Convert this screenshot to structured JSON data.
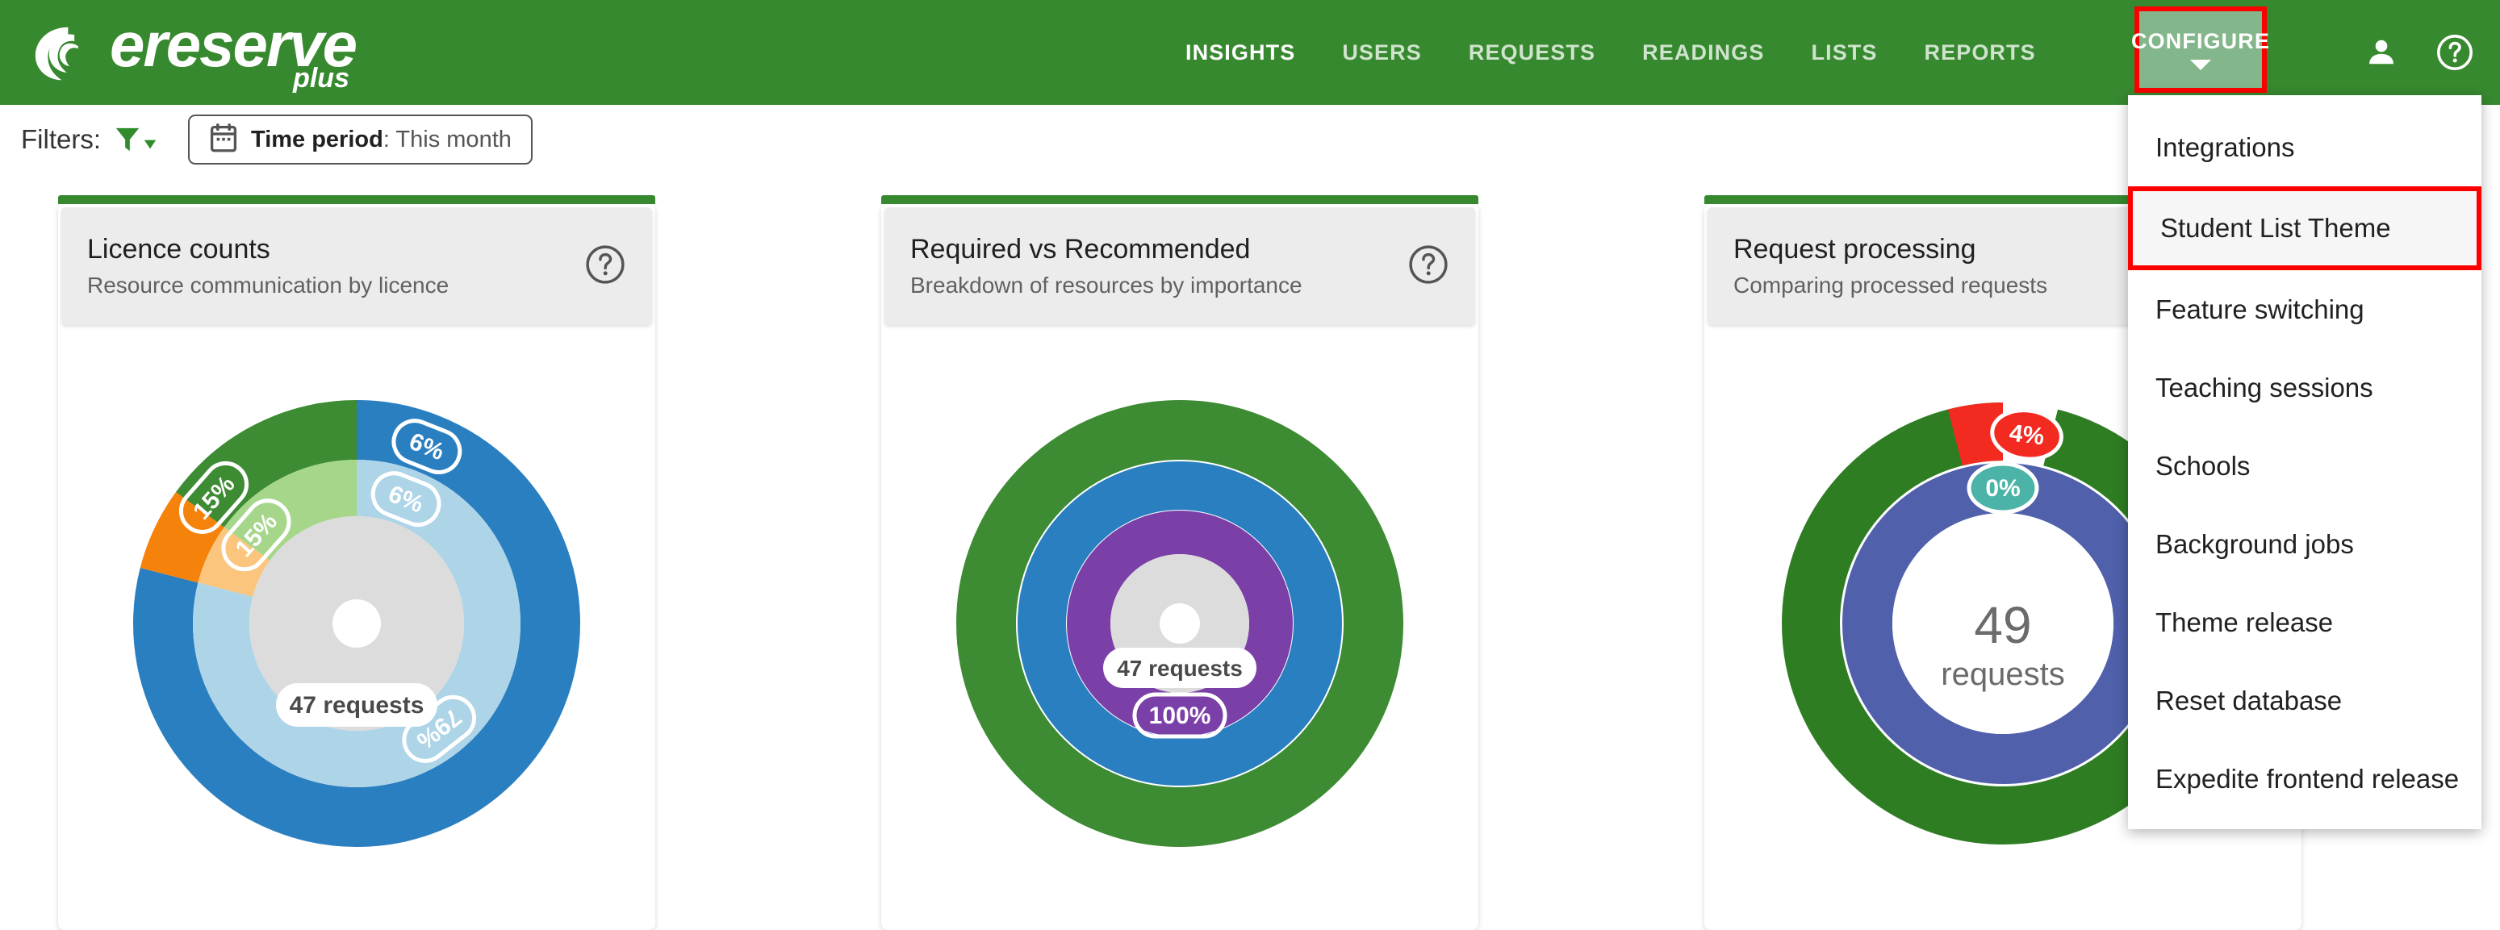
{
  "brand": {
    "name": "ereserve",
    "suffix": "plus",
    "logo_icon": "spiral-swirl-logo-icon",
    "header_color": "#37892f"
  },
  "nav": {
    "items": [
      {
        "label": "INSIGHTS",
        "active": true
      },
      {
        "label": "USERS",
        "active": false
      },
      {
        "label": "REQUESTS",
        "active": false
      },
      {
        "label": "READINGS",
        "active": false
      },
      {
        "label": "LISTS",
        "active": false
      },
      {
        "label": "REPORTS",
        "active": false
      }
    ],
    "configure": {
      "label": "CONFIGURE",
      "highlight_color": "#fc0000",
      "active_bg": "#84b68b",
      "caret_icon": "chevron-down-icon"
    },
    "account_icon": "person-icon",
    "help_icon": "help-circle-icon"
  },
  "dropdown": {
    "selected": "Student List Theme",
    "highlight_color": "#fc0000",
    "items": [
      {
        "label": "Integrations",
        "selected": false
      },
      {
        "label": "Student List Theme",
        "selected": true
      },
      {
        "label": "Feature switching",
        "selected": false
      },
      {
        "label": "Teaching sessions",
        "selected": false
      },
      {
        "label": "Schools",
        "selected": false
      },
      {
        "label": "Background jobs",
        "selected": false
      },
      {
        "label": "Theme release",
        "selected": false
      },
      {
        "label": "Reset database",
        "selected": false
      },
      {
        "label": "Expedite frontend release",
        "selected": false
      }
    ]
  },
  "filters": {
    "label": "Filters:",
    "funnel_icon": "filter-funnel-icon",
    "time_period": {
      "calendar_icon": "calendar-icon",
      "key": "Time period",
      "separator": ": ",
      "value": "This month"
    }
  },
  "cards": [
    {
      "title": "Licence counts",
      "subtitle": "Resource communication by licence",
      "help_icon": "help-circle-icon"
    },
    {
      "title": "Required vs Recommended",
      "subtitle": "Breakdown of resources by importance",
      "help_icon": "help-circle-icon"
    },
    {
      "title": "Request processing",
      "subtitle": "Comparing processed requests",
      "help_icon": "help-circle-icon"
    }
  ],
  "chart_data": [
    {
      "type": "pie",
      "title": "Licence counts",
      "subtitle": "Resource communication by licence",
      "variant": "multi-ring-sunburst",
      "center_label": "47 requests",
      "center_value": 47,
      "center_unit": "requests",
      "rings": [
        {
          "name": "outer",
          "slices": [
            {
              "label": "79%",
              "value": 79,
              "color": "#2a7fc0",
              "show_label": false
            },
            {
              "label": "6%",
              "value": 6,
              "color": "#f5820b",
              "show_label": true
            },
            {
              "label": "15%",
              "value": 15,
              "color": "#3d8b33",
              "show_label": true
            }
          ]
        },
        {
          "name": "inner",
          "slices": [
            {
              "label": "79%",
              "value": 79,
              "color": "#aed4e8",
              "show_label": true
            },
            {
              "label": "6%",
              "value": 6,
              "color": "#fbc57e",
              "show_label": true
            },
            {
              "label": "15%",
              "value": 15,
              "color": "#a5d68a",
              "show_label": true
            }
          ]
        }
      ],
      "hub_color": "#dcdcdc"
    },
    {
      "type": "pie",
      "title": "Required vs Recommended",
      "subtitle": "Breakdown of resources by importance",
      "variant": "multi-ring-sunburst",
      "center_label": "47 requests",
      "center_value": 47,
      "center_unit": "requests",
      "rings": [
        {
          "name": "outer",
          "slices": [
            {
              "label": "100%",
              "value": 100,
              "color": "#3d8b33",
              "show_label": false
            }
          ]
        },
        {
          "name": "middle",
          "slices": [
            {
              "label": "100%",
              "value": 100,
              "color": "#2a7fc0",
              "show_label": false
            }
          ]
        },
        {
          "name": "inner",
          "slices": [
            {
              "label": "100%",
              "value": 100,
              "color": "#7b3fa8",
              "show_label": true
            }
          ]
        }
      ],
      "hub_color": "#dcdcdc"
    },
    {
      "type": "pie",
      "title": "Request processing",
      "subtitle": "Comparing processed requests",
      "variant": "multi-ring-donut",
      "center_value": "49",
      "center_unit": "requests",
      "rings": [
        {
          "name": "outer",
          "slices": [
            {
              "label": "96%",
              "value": 96,
              "color": "#2e7d23",
              "show_label": false
            },
            {
              "label": "4%",
              "value": 4,
              "color": "#f22a20",
              "show_label": true,
              "badge_fill": "#f22a20"
            }
          ]
        },
        {
          "name": "inner",
          "slices": [
            {
              "label": "100%",
              "value": 100,
              "color": "#5060ab",
              "show_label": false
            },
            {
              "label": "0%",
              "value": 0,
              "color": "#4cb3a8",
              "show_label": true,
              "badge_fill": "#4cb3a8"
            }
          ]
        }
      ],
      "hub_color": "#ffffff"
    }
  ]
}
